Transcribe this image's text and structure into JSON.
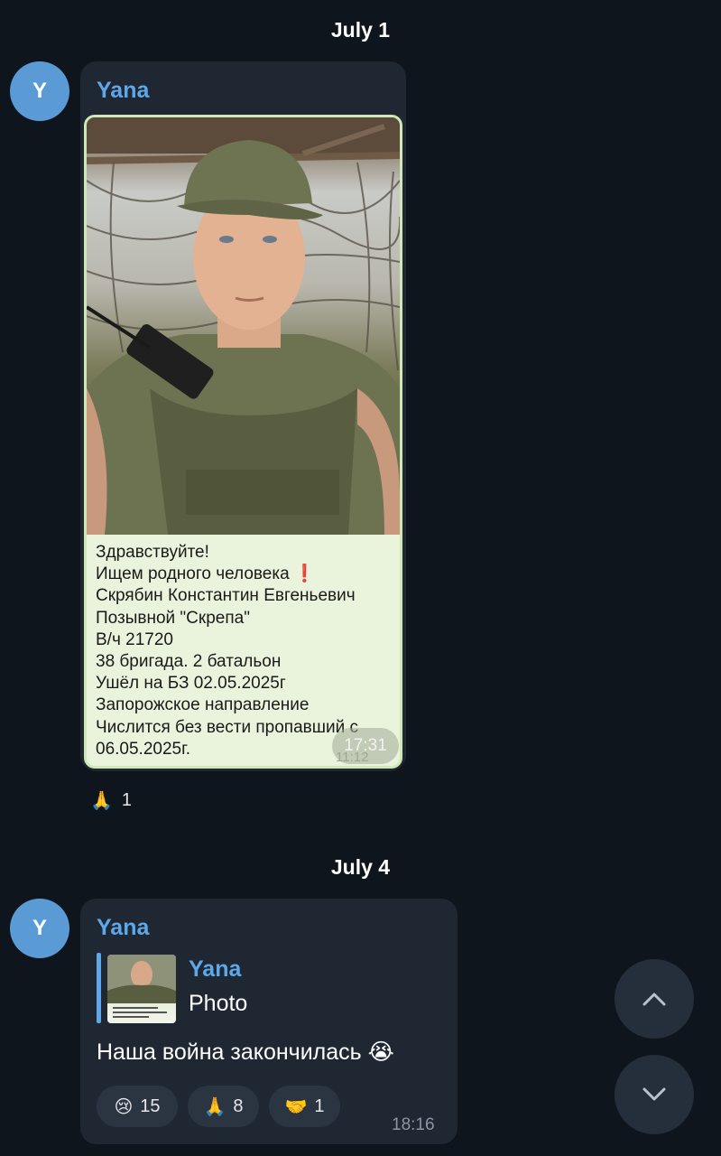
{
  "colors": {
    "background": "#0f151d",
    "bubble": "#1e2732",
    "accent": "#5ea7e8",
    "avatar": "#5b9bd5",
    "photo_card": "#eaf4dd"
  },
  "date_separators": [
    "July 1",
    "July 4"
  ],
  "avatar_letter": "Y",
  "message1": {
    "sender": "Yana",
    "photo_caption_lines": [
      "Здравствуйте!",
      "Ищем родного человека ❗",
      "Скрябин Константин Евгеньевич",
      "Позывной \"Скрепа\"",
      "В/ч 21720",
      "38 бригада. 2 батальон",
      "Ушёл на БЗ  02.05.2025г",
      "Запорожское направление",
      "Числится без вести пропавший с",
      "06.05.2025г."
    ],
    "inner_time": "17:31",
    "inner_time_ghost": "11:12",
    "reaction": {
      "emoji": "🙏",
      "count": "1"
    }
  },
  "message2": {
    "sender": "Yana",
    "reply": {
      "name": "Yana",
      "text": "Photo"
    },
    "text": "Наша война закончилась 😭",
    "reactions": [
      {
        "emoji": "😢",
        "count": "15"
      },
      {
        "emoji": "🙏",
        "count": "8"
      },
      {
        "emoji": "🤝",
        "count": "1"
      }
    ],
    "time": "18:16"
  },
  "icons": {
    "scroll_up": "chevron-up-icon",
    "scroll_down": "chevron-down-icon"
  }
}
